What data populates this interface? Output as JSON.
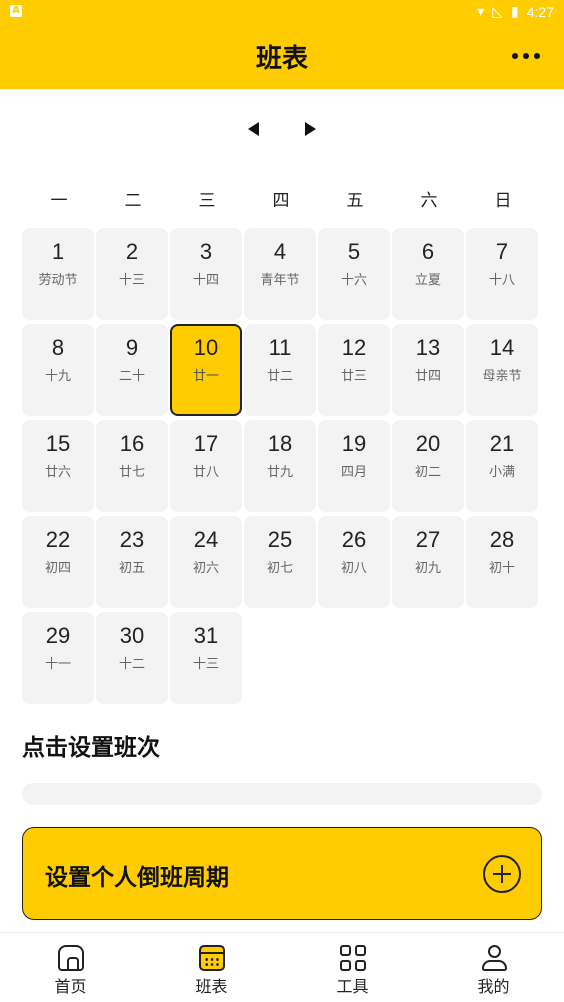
{
  "status": {
    "time": "4:27"
  },
  "header": {
    "title": "班表"
  },
  "calendar": {
    "weekdays": [
      "一",
      "二",
      "三",
      "四",
      "五",
      "六",
      "日"
    ],
    "days": [
      {
        "num": "1",
        "lunar": "劳动节"
      },
      {
        "num": "2",
        "lunar": "十三"
      },
      {
        "num": "3",
        "lunar": "十四"
      },
      {
        "num": "4",
        "lunar": "青年节"
      },
      {
        "num": "5",
        "lunar": "十六"
      },
      {
        "num": "6",
        "lunar": "立夏"
      },
      {
        "num": "7",
        "lunar": "十八"
      },
      {
        "num": "8",
        "lunar": "十九"
      },
      {
        "num": "9",
        "lunar": "二十"
      },
      {
        "num": "10",
        "lunar": "廿一",
        "today": true
      },
      {
        "num": "11",
        "lunar": "廿二"
      },
      {
        "num": "12",
        "lunar": "廿三"
      },
      {
        "num": "13",
        "lunar": "廿四"
      },
      {
        "num": "14",
        "lunar": "母亲节"
      },
      {
        "num": "15",
        "lunar": "廿六"
      },
      {
        "num": "16",
        "lunar": "廿七"
      },
      {
        "num": "17",
        "lunar": "廿八"
      },
      {
        "num": "18",
        "lunar": "廿九"
      },
      {
        "num": "19",
        "lunar": "四月"
      },
      {
        "num": "20",
        "lunar": "初二"
      },
      {
        "num": "21",
        "lunar": "小满"
      },
      {
        "num": "22",
        "lunar": "初四"
      },
      {
        "num": "23",
        "lunar": "初五"
      },
      {
        "num": "24",
        "lunar": "初六"
      },
      {
        "num": "25",
        "lunar": "初七"
      },
      {
        "num": "26",
        "lunar": "初八"
      },
      {
        "num": "27",
        "lunar": "初九"
      },
      {
        "num": "28",
        "lunar": "初十"
      },
      {
        "num": "29",
        "lunar": "十一"
      },
      {
        "num": "30",
        "lunar": "十二"
      },
      {
        "num": "31",
        "lunar": "十三"
      }
    ]
  },
  "shift": {
    "set_title": "点击设置班次",
    "cycle_button": "设置个人倒班周期"
  },
  "tabbar": {
    "items": [
      {
        "label": "首页",
        "icon": "home-icon"
      },
      {
        "label": "班表",
        "icon": "calendar-icon"
      },
      {
        "label": "工具",
        "icon": "tools-icon"
      },
      {
        "label": "我的",
        "icon": "profile-icon"
      }
    ]
  },
  "colors": {
    "accent": "#FFCC00",
    "cell_bg": "#f3f3f3"
  }
}
